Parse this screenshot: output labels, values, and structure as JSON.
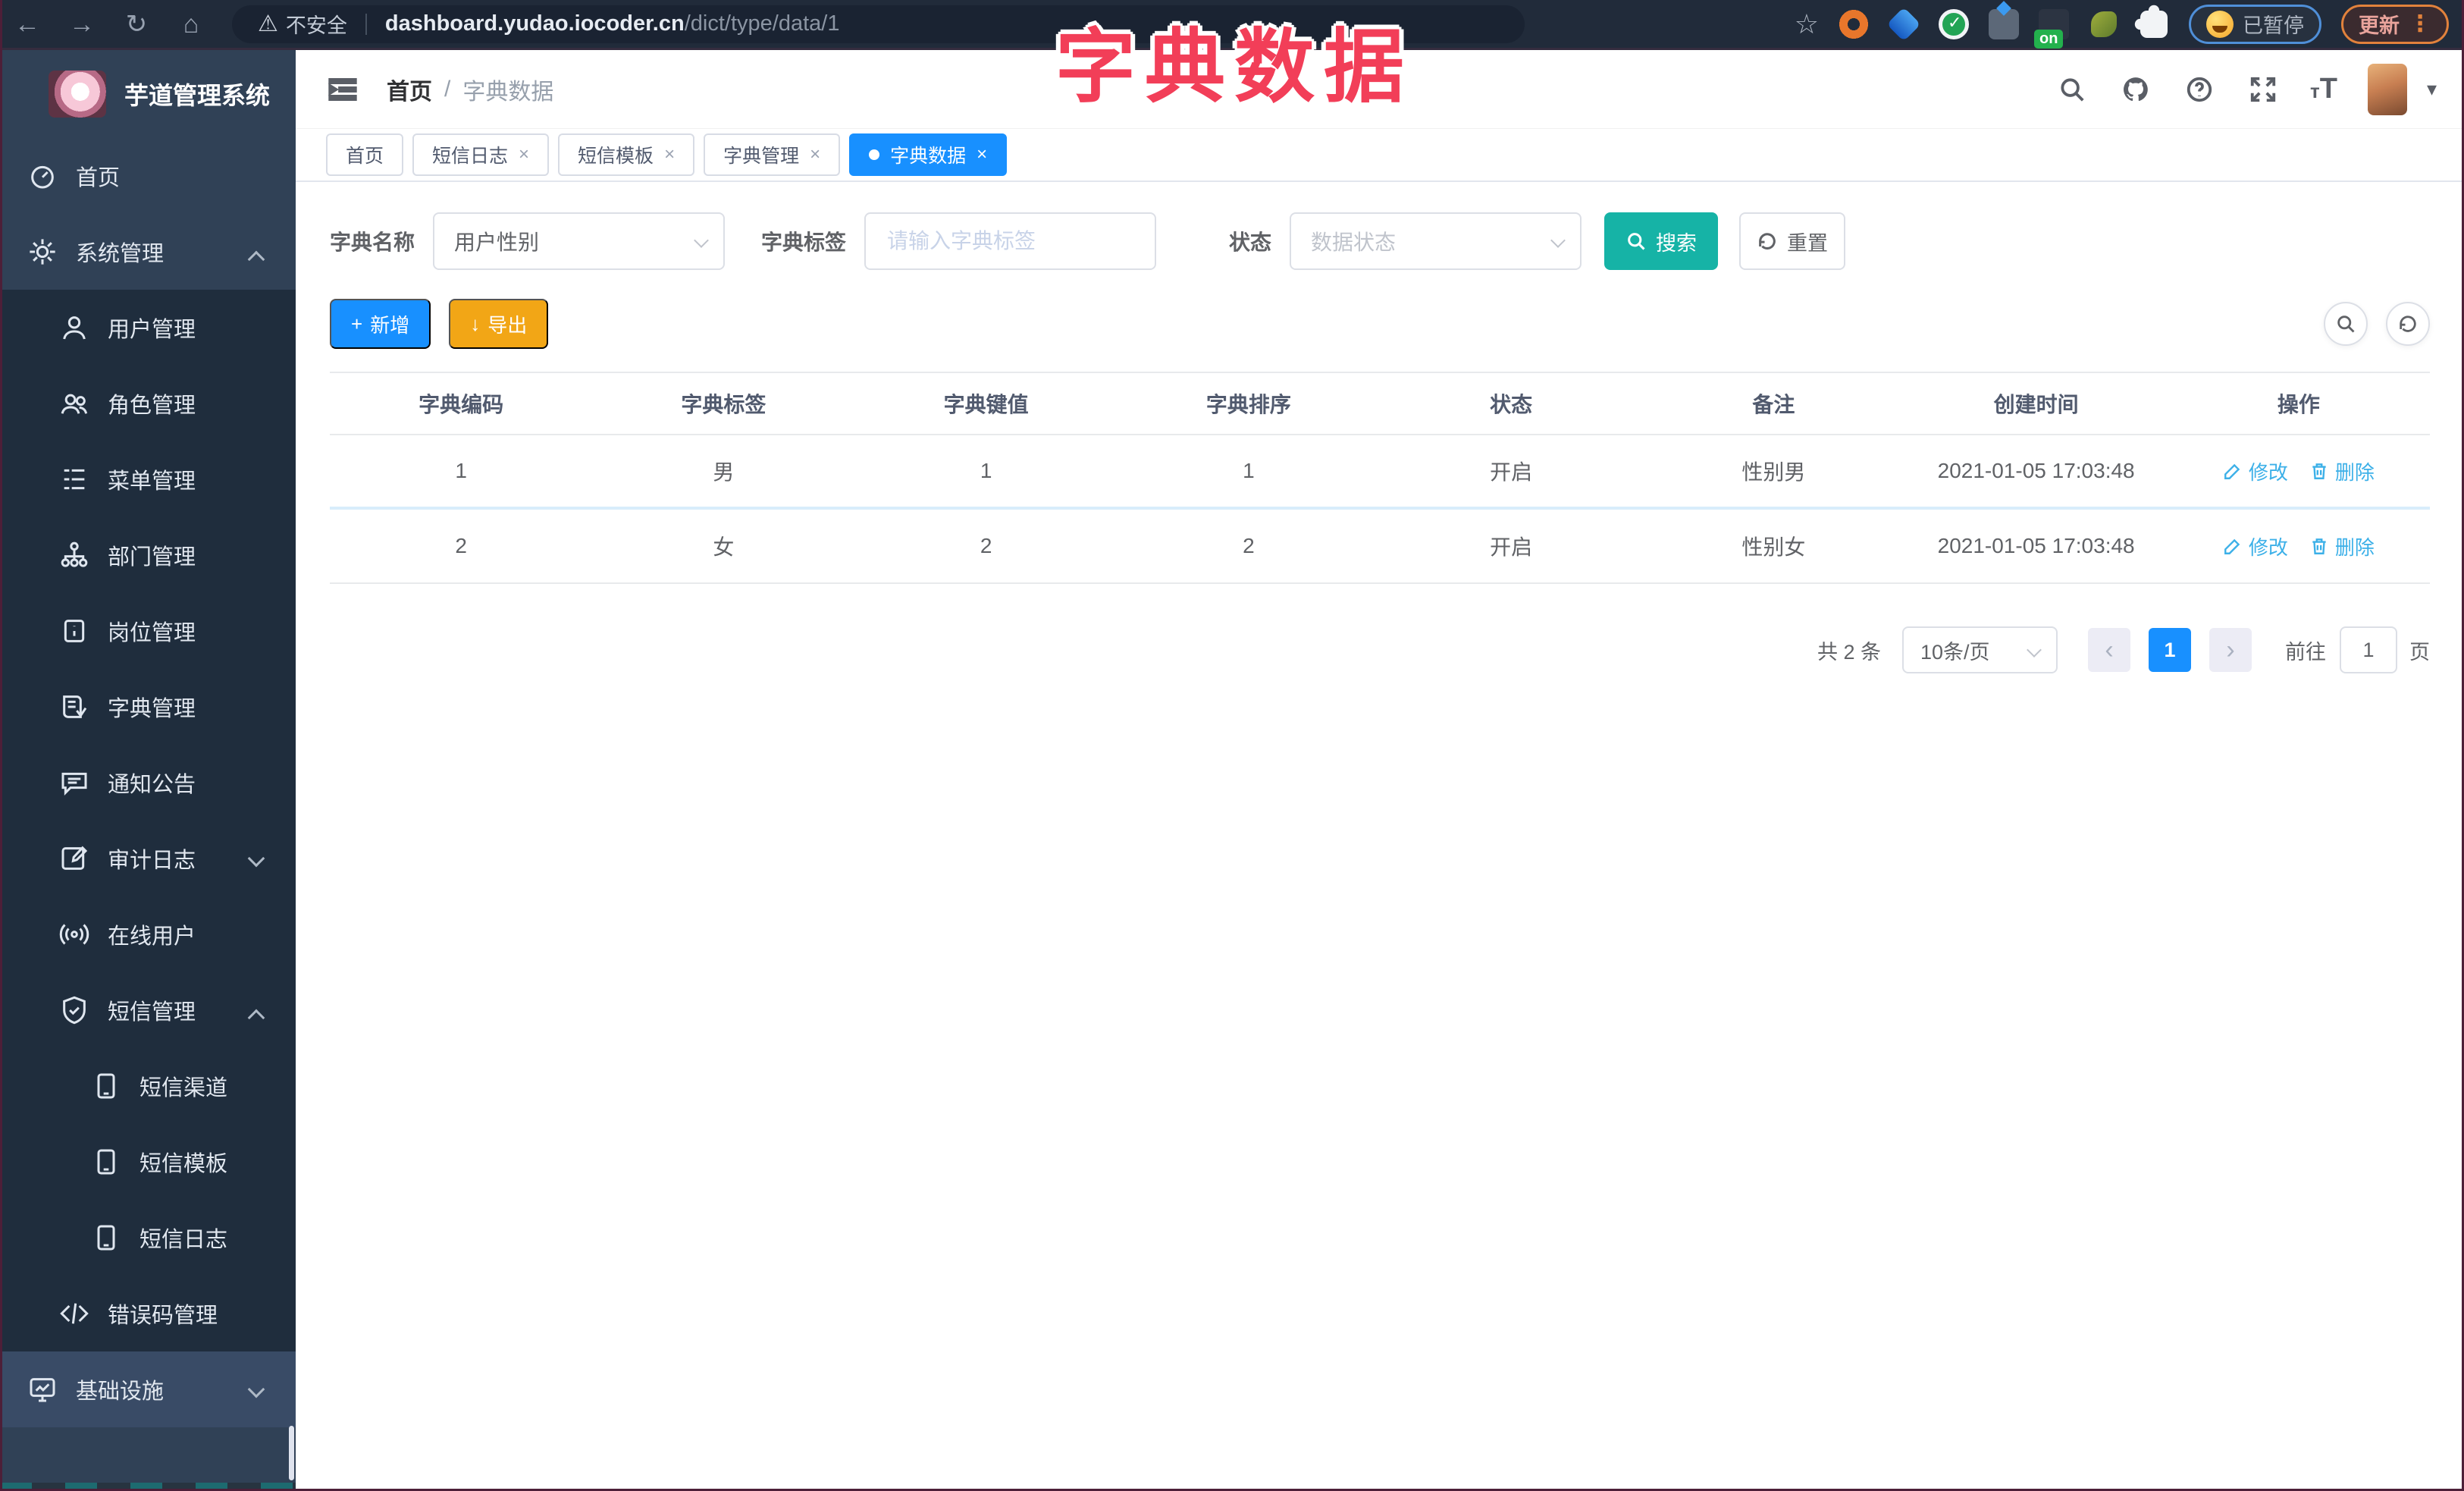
{
  "browser": {
    "security_warning": "不安全",
    "url_host": "dashboard.yudao.iocoder.cn",
    "url_path": "/dict/type/data/1",
    "on_badge": "on",
    "paused_badge": "已暂停",
    "update_button": "更新",
    "menu_dots": "⋮"
  },
  "overlay_title": "字典数据",
  "sidebar": {
    "app_title": "芋道管理系统",
    "items": [
      {
        "label": "首页",
        "icon": "dashboard-icon"
      },
      {
        "label": "系统管理",
        "icon": "gear-icon",
        "chevron": "up"
      },
      {
        "label": "用户管理",
        "icon": "user-icon"
      },
      {
        "label": "角色管理",
        "icon": "users-icon"
      },
      {
        "label": "菜单管理",
        "icon": "menu-list-icon"
      },
      {
        "label": "部门管理",
        "icon": "org-tree-icon"
      },
      {
        "label": "岗位管理",
        "icon": "post-icon"
      },
      {
        "label": "字典管理",
        "icon": "dict-book-icon"
      },
      {
        "label": "通知公告",
        "icon": "announcement-icon"
      },
      {
        "label": "审计日志",
        "icon": "audit-log-icon",
        "chevron": "down"
      },
      {
        "label": "在线用户",
        "icon": "online-user-icon"
      },
      {
        "label": "短信管理",
        "icon": "shield-check-icon",
        "chevron": "up"
      },
      {
        "label": "短信渠道",
        "icon": "phone-icon"
      },
      {
        "label": "短信模板",
        "icon": "phone-icon"
      },
      {
        "label": "短信日志",
        "icon": "phone-icon"
      },
      {
        "label": "错误码管理",
        "icon": "code-icon"
      },
      {
        "label": "基础设施",
        "icon": "monitor-icon",
        "chevron": "down"
      }
    ]
  },
  "header": {
    "breadcrumb_home": "首页",
    "breadcrumb_sep": "/",
    "breadcrumb_current": "字典数据"
  },
  "tabs": [
    {
      "label": "首页"
    },
    {
      "label": "短信日志"
    },
    {
      "label": "短信模板"
    },
    {
      "label": "字典管理"
    },
    {
      "label": "字典数据"
    }
  ],
  "filters": {
    "dict_name_label": "字典名称",
    "dict_name_value": "用户性别",
    "dict_label_label": "字典标签",
    "dict_label_placeholder": "请输入字典标签",
    "status_label": "状态",
    "status_placeholder": "数据状态",
    "search_button": "搜索",
    "reset_button": "重置"
  },
  "toolbar": {
    "add_button": "新增",
    "export_button": "导出"
  },
  "table": {
    "columns": [
      "字典编码",
      "字典标签",
      "字典键值",
      "字典排序",
      "状态",
      "备注",
      "创建时间",
      "操作"
    ],
    "edit_label": "修改",
    "delete_label": "删除",
    "rows": [
      {
        "code": "1",
        "label": "男",
        "value": "1",
        "sort": "1",
        "status": "开启",
        "remark": "性别男",
        "create_time": "2021-01-05 17:03:48"
      },
      {
        "code": "2",
        "label": "女",
        "value": "2",
        "sort": "2",
        "status": "开启",
        "remark": "性别女",
        "create_time": "2021-01-05 17:03:48"
      }
    ]
  },
  "pagination": {
    "total_text": "共 2 条",
    "page_size": "10条/页",
    "prev": "‹",
    "next": "›",
    "current_page": "1",
    "goto_label": "前往",
    "goto_value": "1",
    "page_unit": "页"
  },
  "colors": {
    "accent_blue": "#1890ff",
    "teal_search": "#16b3a6",
    "orange_export": "#f2a616",
    "annotation_pink": "#f23e58",
    "link_cyan": "#3cb0e8",
    "sidebar_bg": "#304156",
    "submenu_bg": "#1f2d3d",
    "chrome_bg": "#212b3a"
  }
}
